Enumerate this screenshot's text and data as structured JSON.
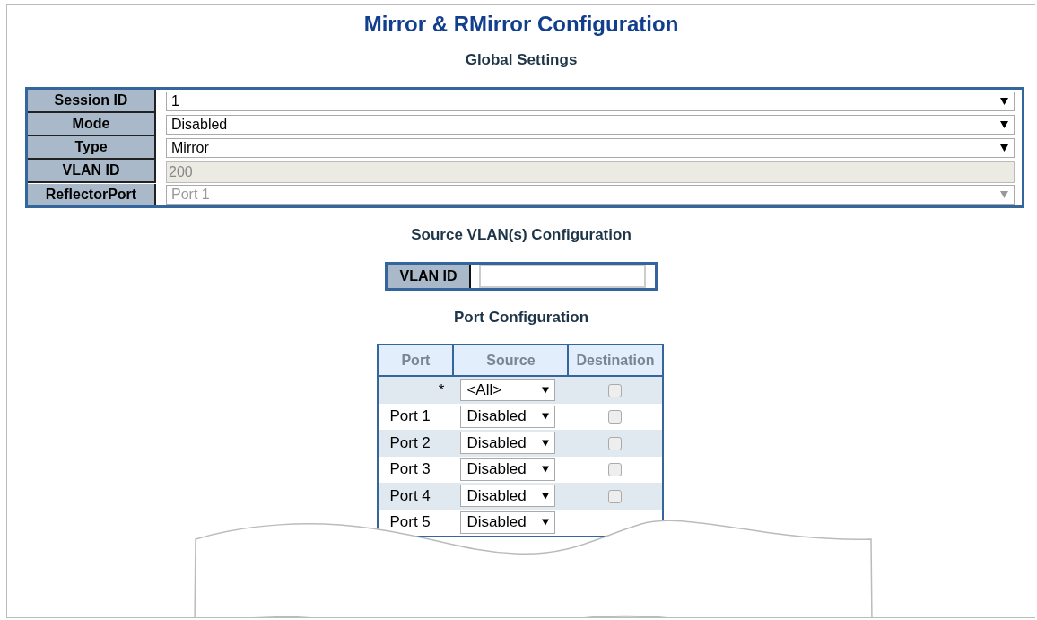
{
  "title": "Mirror & RMirror Configuration",
  "global_settings": {
    "heading": "Global Settings",
    "rows": [
      {
        "label": "Session ID",
        "kind": "select",
        "value": "1",
        "disabled": false
      },
      {
        "label": "Mode",
        "kind": "select",
        "value": "Disabled",
        "disabled": false
      },
      {
        "label": "Type",
        "kind": "select",
        "value": "Mirror",
        "disabled": false
      },
      {
        "label": "VLAN ID",
        "kind": "input",
        "value": "200",
        "disabled": true
      },
      {
        "label": "ReflectorPort",
        "kind": "select",
        "value": "Port 1",
        "disabled": true
      }
    ]
  },
  "source_vlan": {
    "heading": "Source VLAN(s) Configuration",
    "label": "VLAN ID"
  },
  "port_configuration": {
    "heading": "Port Configuration",
    "columns": [
      "Port",
      "Source",
      "Destination"
    ],
    "rows": [
      {
        "port": "*",
        "source": "<All>",
        "checked": false
      },
      {
        "port": "Port 1",
        "source": "Disabled",
        "checked": false
      },
      {
        "port": "Port 2",
        "source": "Disabled",
        "checked": false
      },
      {
        "port": "Port 3",
        "source": "Disabled",
        "checked": false
      },
      {
        "port": "Port 4",
        "source": "Disabled",
        "checked": false
      },
      {
        "port": "Port 5",
        "source": "Disabled"
      }
    ]
  }
}
